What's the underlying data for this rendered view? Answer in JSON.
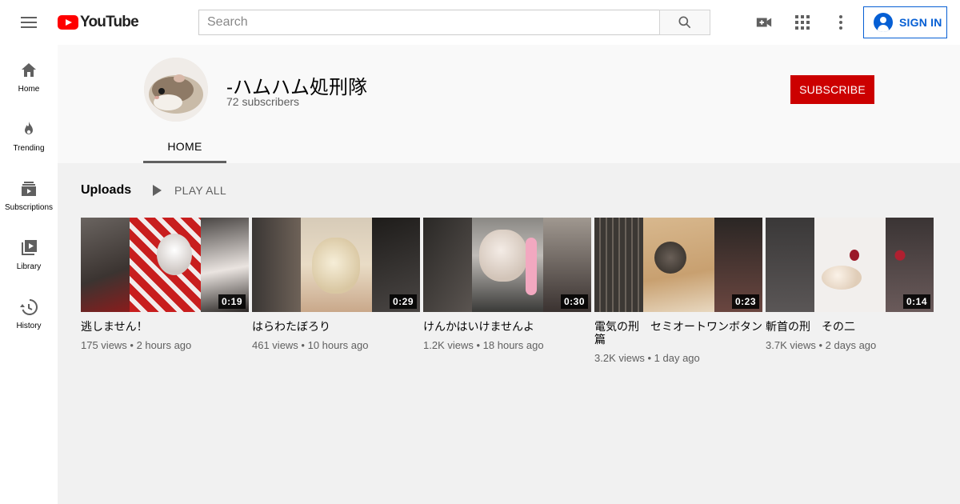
{
  "header": {
    "logo_text": "YouTube",
    "search_placeholder": "Search",
    "signin_label": "SIGN IN"
  },
  "sidebar": {
    "items": [
      {
        "label": "Home",
        "icon": "home-icon"
      },
      {
        "label": "Trending",
        "icon": "fire-icon"
      },
      {
        "label": "Subscriptions",
        "icon": "subscriptions-icon"
      },
      {
        "label": "Library",
        "icon": "library-icon"
      },
      {
        "label": "History",
        "icon": "history-icon"
      }
    ]
  },
  "channel": {
    "name": "-ハムハム処刑隊",
    "subscribers": "72 subscribers",
    "subscribe_label": "SUBSCRIBE",
    "tabs": [
      {
        "label": "HOME"
      }
    ]
  },
  "uploads": {
    "title": "Uploads",
    "play_all_label": "PLAY ALL",
    "videos": [
      {
        "title": "逃しません！",
        "views": "175 views",
        "age": "2 hours ago",
        "duration": "0:19"
      },
      {
        "title": "はらわたぼろり",
        "views": "461 views",
        "age": "10 hours ago",
        "duration": "0:29"
      },
      {
        "title": "けんかはいけませんよ",
        "views": "1.2K views",
        "age": "18 hours ago",
        "duration": "0:30"
      },
      {
        "title": "電気の刑　セミオートワンボタン篇",
        "views": "3.2K views",
        "age": "1 day ago",
        "duration": "0:23"
      },
      {
        "title": "斬首の刑　その二",
        "views": "3.7K views",
        "age": "2 days ago",
        "duration": "0:14"
      }
    ]
  },
  "colors": {
    "brand_red": "#ff0000",
    "subscribe_red": "#cc0000",
    "link_blue": "#065fd4"
  }
}
